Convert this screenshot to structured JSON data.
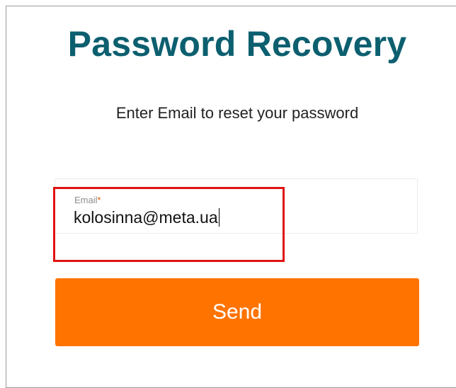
{
  "page": {
    "title": "Password Recovery",
    "subtitle": "Enter Email to reset your password"
  },
  "form": {
    "email": {
      "label": "Email",
      "required_mark": "*",
      "value": "kolosinna@meta.ua"
    },
    "send_label": "Send"
  },
  "colors": {
    "title": "#0c5f6f",
    "button": "#ff7300",
    "highlight": "#e01313"
  }
}
